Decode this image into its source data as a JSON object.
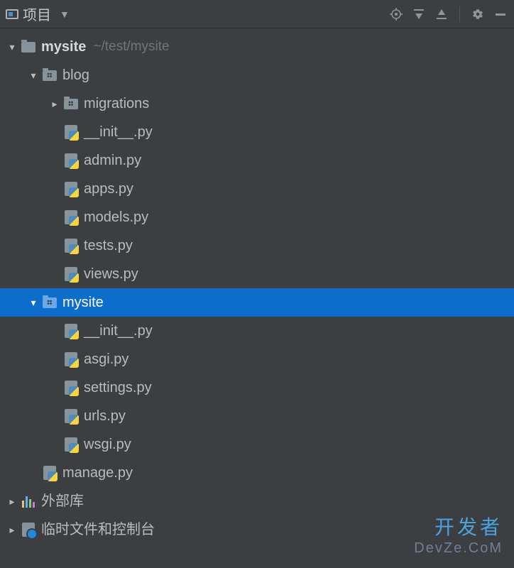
{
  "toolbar": {
    "title": "项目",
    "icons": {
      "target": "target-icon",
      "expand": "expand-all-icon",
      "collapse": "collapse-all-icon",
      "gear": "settings-icon",
      "hide": "hide-icon"
    }
  },
  "tree": {
    "root": {
      "name": "mysite",
      "path": "~/test/mysite"
    },
    "blog": {
      "name": "blog",
      "migrations": "migrations",
      "files": [
        "__init__.py",
        "admin.py",
        "apps.py",
        "models.py",
        "tests.py",
        "views.py"
      ]
    },
    "mysite_pkg": {
      "name": "mysite",
      "files": [
        "__init__.py",
        "asgi.py",
        "settings.py",
        "urls.py",
        "wsgi.py"
      ]
    },
    "manage": "manage.py",
    "ext_lib": "外部库",
    "scratch": "临时文件和控制台"
  },
  "watermark": {
    "cn": "开发者",
    "en": "DevZe.CoM"
  },
  "colors": {
    "selection": "#0d6dcd",
    "bg": "#3c3f41"
  }
}
